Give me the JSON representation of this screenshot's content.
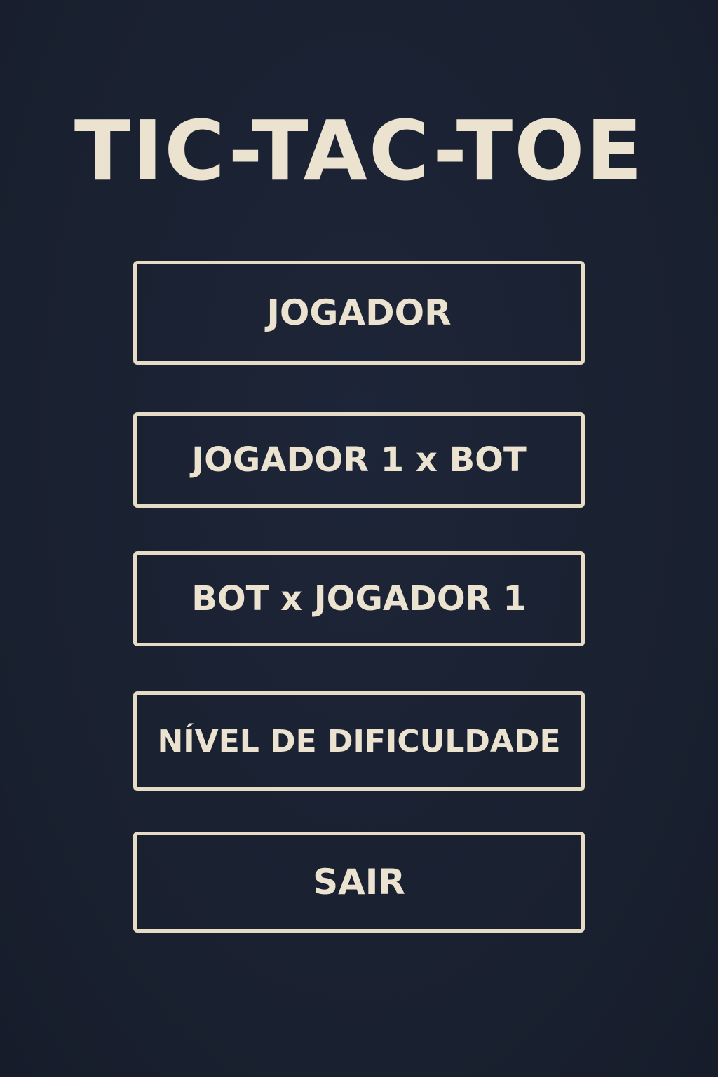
{
  "game": {
    "title": "TIC-TAC-TOE"
  },
  "menu": {
    "buttons": [
      {
        "label": "JOGADOR"
      },
      {
        "label": "JOGADOR 1 x BOT"
      },
      {
        "label": "BOT x JOGADOR 1"
      },
      {
        "label": "NÍVEL DE DIFICULDADE"
      },
      {
        "label": "SAIR"
      }
    ]
  },
  "colors": {
    "background": "#1a2133",
    "text": "#ebe3cf",
    "border": "#e6dcc6"
  }
}
